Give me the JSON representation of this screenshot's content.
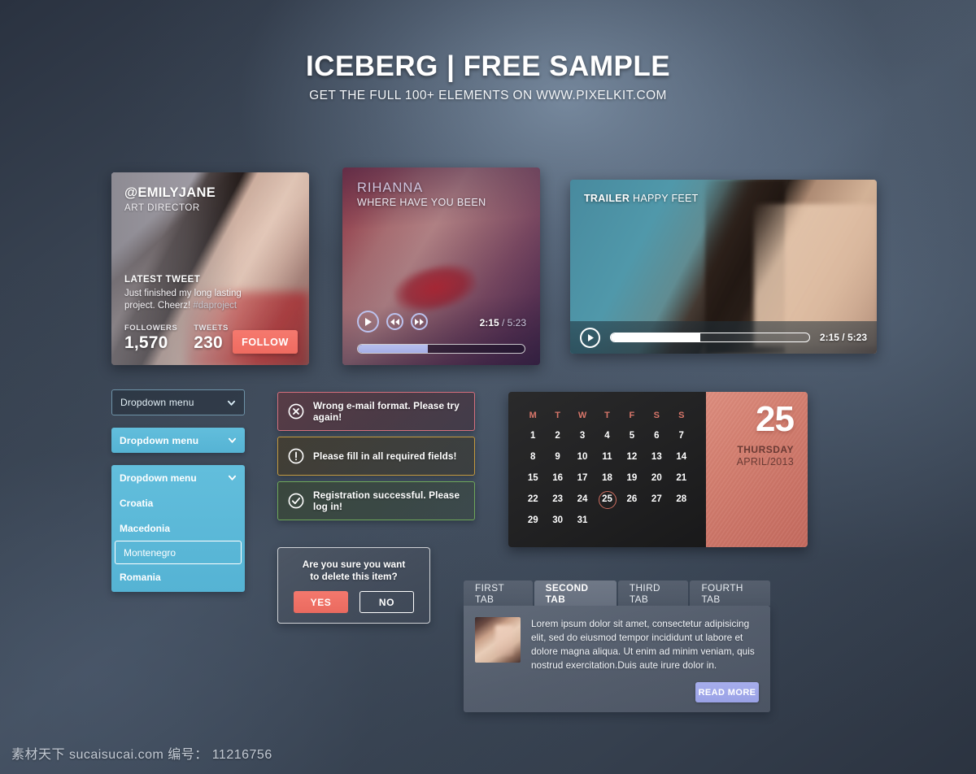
{
  "header": {
    "title": "ICEBERG | FREE SAMPLE",
    "subtitle": "GET THE FULL 100+ ELEMENTS ON WWW.PIXELKIT.COM"
  },
  "profile_card": {
    "handle": "@EMILYJANE",
    "role": "ART DIRECTOR",
    "tweet_label": "LATEST TWEET",
    "tweet_text": "Just finished my long lasting project. Cheerz!",
    "tweet_hashtag": "#daproject",
    "followers_label": "FOLLOWERS",
    "followers_value": "1,570",
    "tweets_label": "TWEETS",
    "tweets_value": "230",
    "follow_button": "FOLLOW",
    "accent_color": "#ef6b60"
  },
  "music_player": {
    "artist": "RIHANNA",
    "track": "WHERE HAVE YOU BEEN",
    "current_time": "2:15",
    "separator": " / ",
    "total_time": "5:23",
    "progress_percent": 42,
    "accent_color": "#b7bfee"
  },
  "video_player": {
    "label": "TRAILER",
    "title": "HAPPY FEET",
    "current_time": "2:15",
    "separator": " / ",
    "total_time": "5:23",
    "progress_percent": 45,
    "accent_color": "#ffffff"
  },
  "dropdowns": {
    "dark": {
      "label": "Dropdown menu"
    },
    "blue": {
      "label": "Dropdown menu"
    },
    "open": {
      "label": "Dropdown menu",
      "options": [
        {
          "label": "Croatia",
          "selected": false
        },
        {
          "label": "Macedonia",
          "selected": false
        },
        {
          "label": "Montenegro",
          "selected": true
        },
        {
          "label": "Romania",
          "selected": false
        }
      ]
    },
    "accent_color": "#55b3d4"
  },
  "alerts": [
    {
      "type": "error",
      "icon": "circle-x-icon",
      "message": "Wrong e-mail format. Please try again!",
      "border_color": "#d6707e"
    },
    {
      "type": "warning",
      "icon": "circle-exclamation-icon",
      "message": "Please fill in all required fields!",
      "border_color": "#c49a3e"
    },
    {
      "type": "success",
      "icon": "circle-check-icon",
      "message": "Registration successful. Please log in!",
      "border_color": "#6fa85a"
    }
  ],
  "dialog": {
    "line1": "Are you sure you want",
    "line2": "to delete this item?",
    "yes_label": "YES",
    "no_label": "NO"
  },
  "calendar": {
    "weekday_headers": [
      "M",
      "T",
      "W",
      "T",
      "F",
      "S",
      "S"
    ],
    "weeks": [
      [
        "1",
        "2",
        "3",
        "4",
        "5",
        "6",
        "7"
      ],
      [
        "8",
        "9",
        "10",
        "11",
        "12",
        "13",
        "14"
      ],
      [
        "15",
        "16",
        "17",
        "18",
        "19",
        "20",
        "21"
      ],
      [
        "22",
        "23",
        "24",
        "25",
        "26",
        "27",
        "28"
      ],
      [
        "29",
        "30",
        "31",
        "",
        "",
        "",
        ""
      ]
    ],
    "today": "25",
    "panel_day": "25",
    "panel_weekday": "THURSDAY",
    "panel_monthyear": "APRIL/2013",
    "accent_color": "#cc7467"
  },
  "tabs": {
    "items": [
      {
        "label": "FIRST TAB",
        "active": false
      },
      {
        "label": "SECOND TAB",
        "active": true
      },
      {
        "label": "THIRD TAB",
        "active": false
      },
      {
        "label": "FOURTH TAB",
        "active": false
      }
    ],
    "panel_text": "Lorem ipsum dolor sit amet, consectetur adipisicing elit, sed do eiusmod tempor incididunt ut labore et dolore magna aliqua. Ut enim ad minim veniam, quis nostrud exercitation.Duis aute irure dolor in.",
    "read_more_label": "READ MORE",
    "accent_color": "#9aa2e6"
  },
  "watermark": "素材天下 sucaisucai.com  编号： 11216756"
}
